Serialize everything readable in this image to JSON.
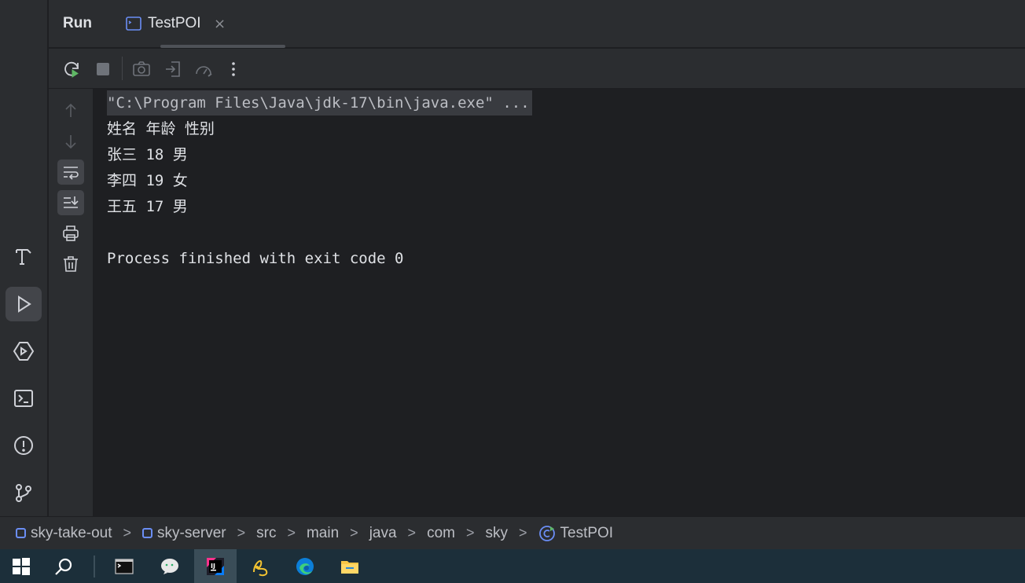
{
  "header": {
    "title": "Run",
    "tab": {
      "label": "TestPOI",
      "close": "×"
    }
  },
  "toolbar": {
    "buttons": [
      "rerun-icon",
      "stop-icon",
      "camera-icon",
      "login-icon",
      "profiler-icon",
      "more-vertical-icon"
    ]
  },
  "console": {
    "command": "\"C:\\Program Files\\Java\\jdk-17\\bin\\java.exe\" ...",
    "output": [
      "姓名 年龄 性别",
      "张三 18 男",
      "李四 19 女",
      "王五 17 男"
    ],
    "exit_message": "Process finished with exit code 0"
  },
  "breadcrumb": {
    "items": [
      "sky-take-out",
      "sky-server",
      "src",
      "main",
      "java",
      "com",
      "sky",
      "TestPOI"
    ],
    "separator": ">"
  },
  "colors": {
    "background": "#1e1f22",
    "panel": "#2b2d30",
    "accent": "#3574f0",
    "run_green": "#5fb865"
  }
}
